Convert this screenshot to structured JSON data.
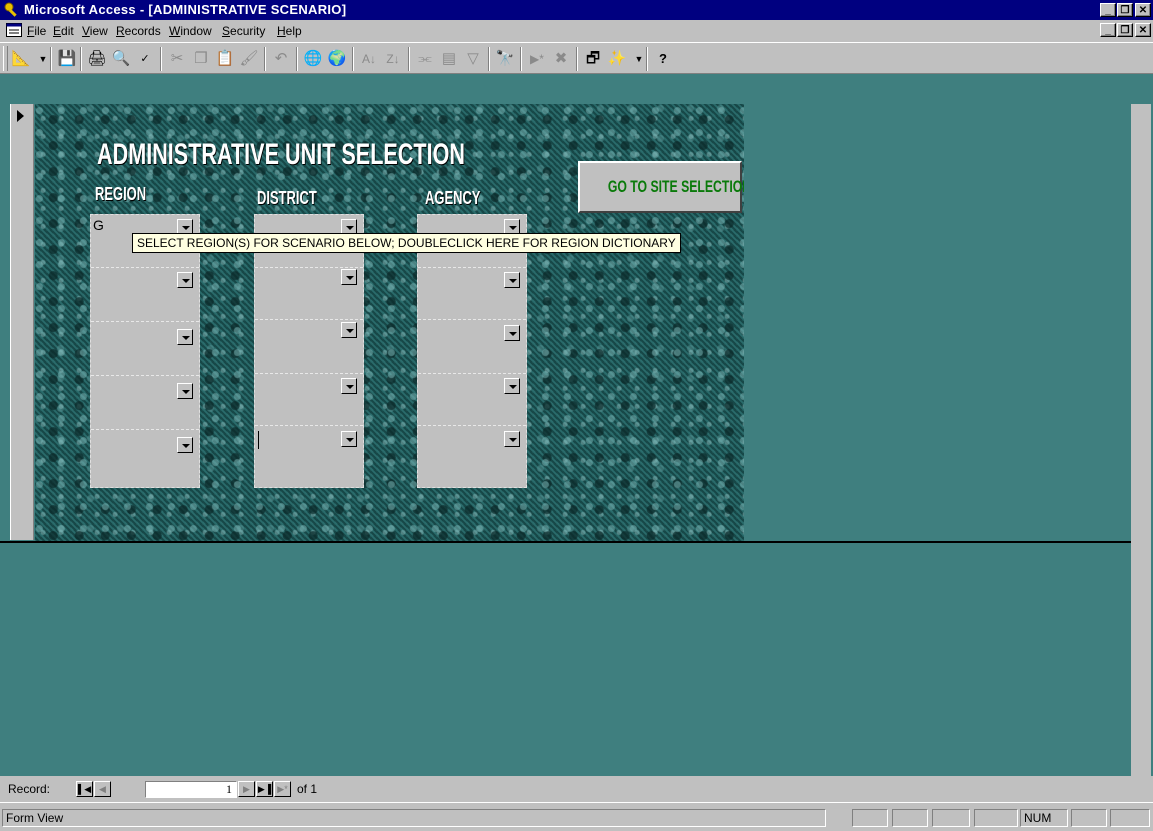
{
  "window": {
    "app_title": "Microsoft Access - [ADMINISTRATIVE SCENARIO]",
    "controls": [
      "_",
      "□",
      "×"
    ]
  },
  "menu": {
    "items": [
      {
        "label": "File",
        "accel": "F"
      },
      {
        "label": "Edit",
        "accel": "E"
      },
      {
        "label": "View",
        "accel": "V"
      },
      {
        "label": "Records",
        "accel": "R"
      },
      {
        "label": "Window",
        "accel": "W"
      },
      {
        "label": "Security",
        "accel": "S"
      },
      {
        "label": "Help",
        "accel": "H"
      }
    ]
  },
  "toolbar": {
    "icons": [
      "design-view-icon",
      "save-icon",
      "print-icon",
      "print-preview-icon",
      "spelling-icon",
      "cut-icon",
      "copy-icon",
      "paste-icon",
      "format-painter-icon",
      "undo-icon",
      "insert-hyperlink-icon",
      "web-toolbar-icon",
      "sort-ascending-icon",
      "sort-descending-icon",
      "filter-by-selection-icon",
      "filter-by-form-icon",
      "apply-filter-icon",
      "find-icon",
      "new-record-icon",
      "delete-record-icon",
      "database-window-icon",
      "new-object-icon",
      "help-icon"
    ]
  },
  "form": {
    "title": "ADMINISTRATIVE UNIT SELECTION",
    "go_button": "GO TO SITE SELECTION",
    "columns": [
      {
        "label": "REGION",
        "values": [
          "G",
          "",
          "",
          "",
          ""
        ]
      },
      {
        "label": "DISTRICT",
        "values": [
          "",
          "",
          "",
          "",
          ""
        ]
      },
      {
        "label": "AGENCY",
        "values": [
          "",
          "",
          "",
          "",
          ""
        ]
      }
    ],
    "tooltip": "SELECT REGION(S) FOR SCENARIO BELOW; DOUBLECLICK HERE FOR REGION DICTIONARY"
  },
  "navigation": {
    "record_label": "Record:",
    "current_record": "1",
    "of_label": "of 1"
  },
  "status": {
    "text": "Form View",
    "num_indicator": "NUM"
  }
}
